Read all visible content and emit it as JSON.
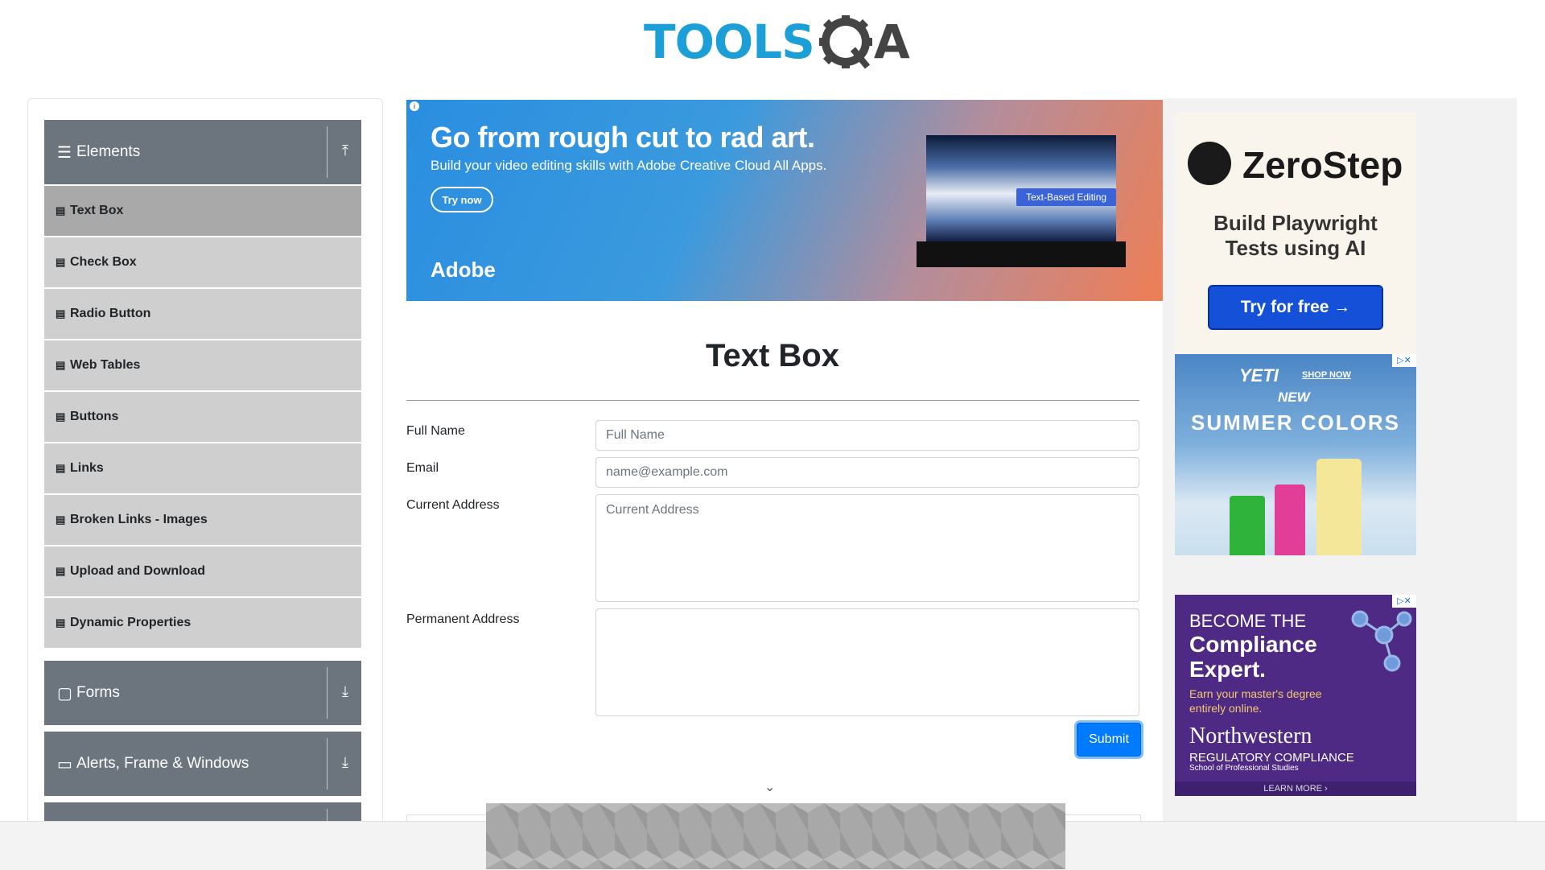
{
  "header": {
    "logo_text_tools": "TOOLS",
    "logo_text_qa": "A"
  },
  "sidebar": {
    "groups": [
      {
        "label": "Elements",
        "icon": "hamburger-icon",
        "state": "expanded"
      },
      {
        "label": "Forms",
        "icon": "form-icon",
        "state": "collapsed"
      },
      {
        "label": "Alerts, Frame & Windows",
        "icon": "window-icon",
        "state": "collapsed"
      }
    ],
    "items": [
      {
        "label": "Text Box",
        "active": true
      },
      {
        "label": "Check Box"
      },
      {
        "label": "Radio Button"
      },
      {
        "label": "Web Tables"
      },
      {
        "label": "Buttons"
      },
      {
        "label": "Links"
      },
      {
        "label": "Broken Links - Images"
      },
      {
        "label": "Upload and Download"
      },
      {
        "label": "Dynamic Properties"
      }
    ]
  },
  "banner": {
    "title": "Go from rough cut to rad art.",
    "subtitle": "Build your video editing skills with Adobe Creative Cloud All Apps.",
    "button": "Try now",
    "brand": "Adobe",
    "tag": "Text-Based Editing"
  },
  "main": {
    "title": "Text Box",
    "form": {
      "full_name_label": "Full Name",
      "full_name_placeholder": "Full Name",
      "email_label": "Email",
      "email_placeholder": "name@example.com",
      "current_address_label": "Current Address",
      "current_address_placeholder": "Current Address",
      "permanent_address_label": "Permanent Address",
      "permanent_address_placeholder": "",
      "submit_label": "Submit"
    }
  },
  "ads": {
    "zerostep": {
      "brand": "ZeroStep",
      "text_line1": "Build Playwright",
      "text_line2": "Tests using AI",
      "button": "Try for free →"
    },
    "yeti": {
      "brand": "YETI",
      "shop": "SHOP NOW",
      "new": "NEW",
      "headline": "SUMMER COLORS"
    },
    "northwestern": {
      "line1": "BECOME THE",
      "line2": "Compliance",
      "line3": "Expert.",
      "line4": "Earn your master's degree entirely online.",
      "brand": "Northwestern",
      "program": "REGULATORY COMPLIANCE",
      "school": "School of Professional Studies",
      "cta": "LEARN MORE ›"
    },
    "ad_choices": "▷✕"
  },
  "colors": {
    "sidebar_header": "#6c757d",
    "sidebar_item": "#cfcfcf",
    "sidebar_active": "#a9a9a9",
    "submit": "#007bff",
    "logo_blue": "#1b9fd6"
  }
}
